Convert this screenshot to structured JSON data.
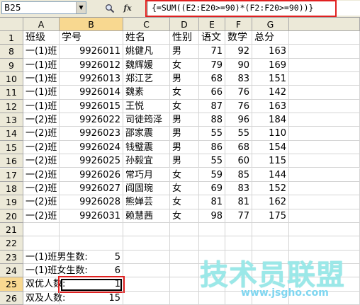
{
  "formula_bar": {
    "cell_ref": "B25",
    "dropdown_icon": "chevron-down-icon",
    "search_icon": "magnifier-icon",
    "function_label": "fx",
    "formula": "{=SUM((E2:E20>=90)*(F2:F20>=90))}"
  },
  "columns": [
    "A",
    "B",
    "C",
    "D",
    "E",
    "F",
    "G"
  ],
  "selected_column": "B",
  "selected_row": "25",
  "rows": [
    {
      "n": "1",
      "cells": [
        "班级",
        "学号",
        "姓名",
        "性别",
        "语文",
        "数学",
        "总分"
      ]
    },
    {
      "n": "8",
      "cells": [
        "一(1)班",
        "9926011",
        "姚健凡",
        "男",
        "71",
        "92",
        "163"
      ]
    },
    {
      "n": "9",
      "cells": [
        "一(1)班",
        "9926012",
        "魏辉媛",
        "女",
        "79",
        "90",
        "169"
      ]
    },
    {
      "n": "10",
      "cells": [
        "一(1)班",
        "9926013",
        "郑江艺",
        "男",
        "68",
        "83",
        "151"
      ]
    },
    {
      "n": "11",
      "cells": [
        "一(1)班",
        "9926014",
        "魏素",
        "女",
        "66",
        "76",
        "142"
      ]
    },
    {
      "n": "12",
      "cells": [
        "一(1)班",
        "9926015",
        "王悦",
        "女",
        "87",
        "76",
        "163"
      ]
    },
    {
      "n": "13",
      "cells": [
        "一(2)班",
        "9926022",
        "司徒筠泽",
        "男",
        "88",
        "96",
        "184"
      ]
    },
    {
      "n": "14",
      "cells": [
        "一(2)班",
        "9926023",
        "邵家震",
        "男",
        "55",
        "55",
        "110"
      ]
    },
    {
      "n": "15",
      "cells": [
        "一(2)班",
        "9926024",
        "钱璧震",
        "男",
        "86",
        "68",
        "154"
      ]
    },
    {
      "n": "16",
      "cells": [
        "一(2)班",
        "9926025",
        "孙毅宜",
        "男",
        "55",
        "60",
        "115"
      ]
    },
    {
      "n": "17",
      "cells": [
        "一(2)班",
        "9926026",
        "常巧月",
        "女",
        "59",
        "85",
        "144"
      ]
    },
    {
      "n": "18",
      "cells": [
        "一(2)班",
        "9926027",
        "阎固琬",
        "女",
        "69",
        "83",
        "152"
      ]
    },
    {
      "n": "19",
      "cells": [
        "一(2)班",
        "9926028",
        "熊婵芸",
        "女",
        "81",
        "81",
        "162"
      ]
    },
    {
      "n": "20",
      "cells": [
        "一(2)班",
        "9926031",
        "赖慧茜",
        "女",
        "98",
        "77",
        "175"
      ]
    },
    {
      "n": "21",
      "cells": [
        "",
        "",
        "",
        "",
        "",
        "",
        ""
      ]
    },
    {
      "n": "22",
      "cells": [
        "",
        "",
        "",
        "",
        "",
        "",
        ""
      ]
    },
    {
      "n": "23",
      "cells": [
        "一(1)班男生数:",
        "5",
        "",
        "",
        "",
        "",
        ""
      ]
    },
    {
      "n": "24",
      "cells": [
        "一(1)班女生数:",
        "6",
        "",
        "",
        "",
        "",
        ""
      ]
    },
    {
      "n": "25",
      "cells": [
        "双优人数:",
        "1",
        "",
        "",
        "",
        "",
        ""
      ]
    },
    {
      "n": "26",
      "cells": [
        "双及人数:",
        "15",
        "",
        "",
        "",
        "",
        ""
      ]
    }
  ],
  "watermark": {
    "title": "技术员联盟",
    "url": "www.jsgho.com"
  },
  "colors": {
    "highlight_red": "#e02020",
    "header_bg": "#ece9d8",
    "selected_header_bg": "#f8d890"
  }
}
